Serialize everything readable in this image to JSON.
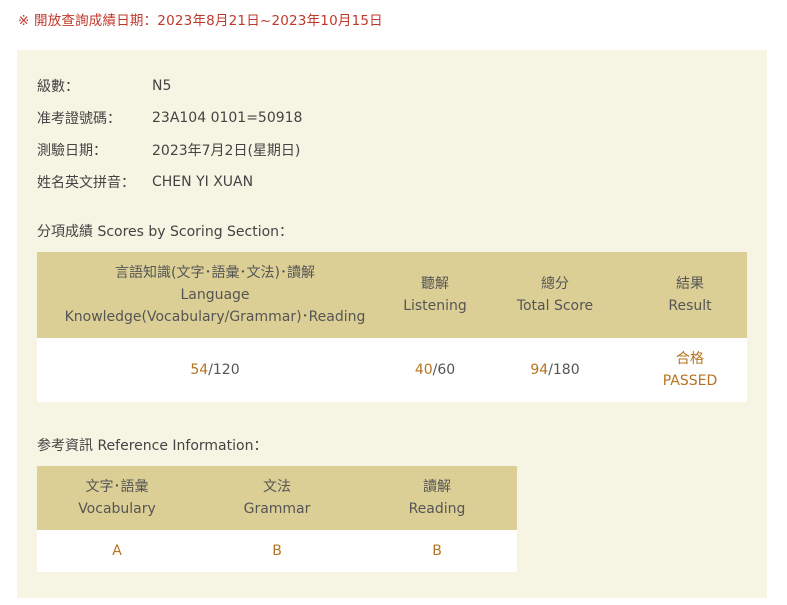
{
  "notice": "※ 開放查詢成績日期：2023年8月21日~2023年10月15日",
  "info": [
    {
      "label": "級數：",
      "value": "N5"
    },
    {
      "label": "准考證號碼：",
      "value": "23A104 0101=50918"
    },
    {
      "label": "測驗日期：",
      "value": "2023年7月2日(星期日)"
    },
    {
      "label": "姓名英文拼音：",
      "value": "CHEN YI XUAN"
    }
  ],
  "scores_section": {
    "title": "分項成績 Scores by Scoring Section：",
    "headers": {
      "language": [
        "言語知識(文字･語彙･文法)･讀解",
        "Language",
        "Knowledge(Vocabulary/Grammar)･Reading"
      ],
      "listening": [
        "聽解",
        "Listening"
      ],
      "total": [
        "總分",
        "Total Score"
      ],
      "result": [
        "結果",
        "Result"
      ]
    },
    "row": {
      "language": {
        "score": "54",
        "max": "/120"
      },
      "listening": {
        "score": "40",
        "max": "/60"
      },
      "total": {
        "score": "94",
        "max": "/180"
      },
      "result": [
        "合格",
        "PASSED"
      ]
    }
  },
  "reference_section": {
    "title": "参考資訊 Reference Information：",
    "headers": {
      "vocabulary": [
        "文字･語彙",
        "Vocabulary"
      ],
      "grammar": [
        "文法",
        "Grammar"
      ],
      "reading": [
        "讀解",
        "Reading"
      ]
    },
    "row": {
      "vocabulary": "A",
      "grammar": "B",
      "reading": "B"
    }
  }
}
